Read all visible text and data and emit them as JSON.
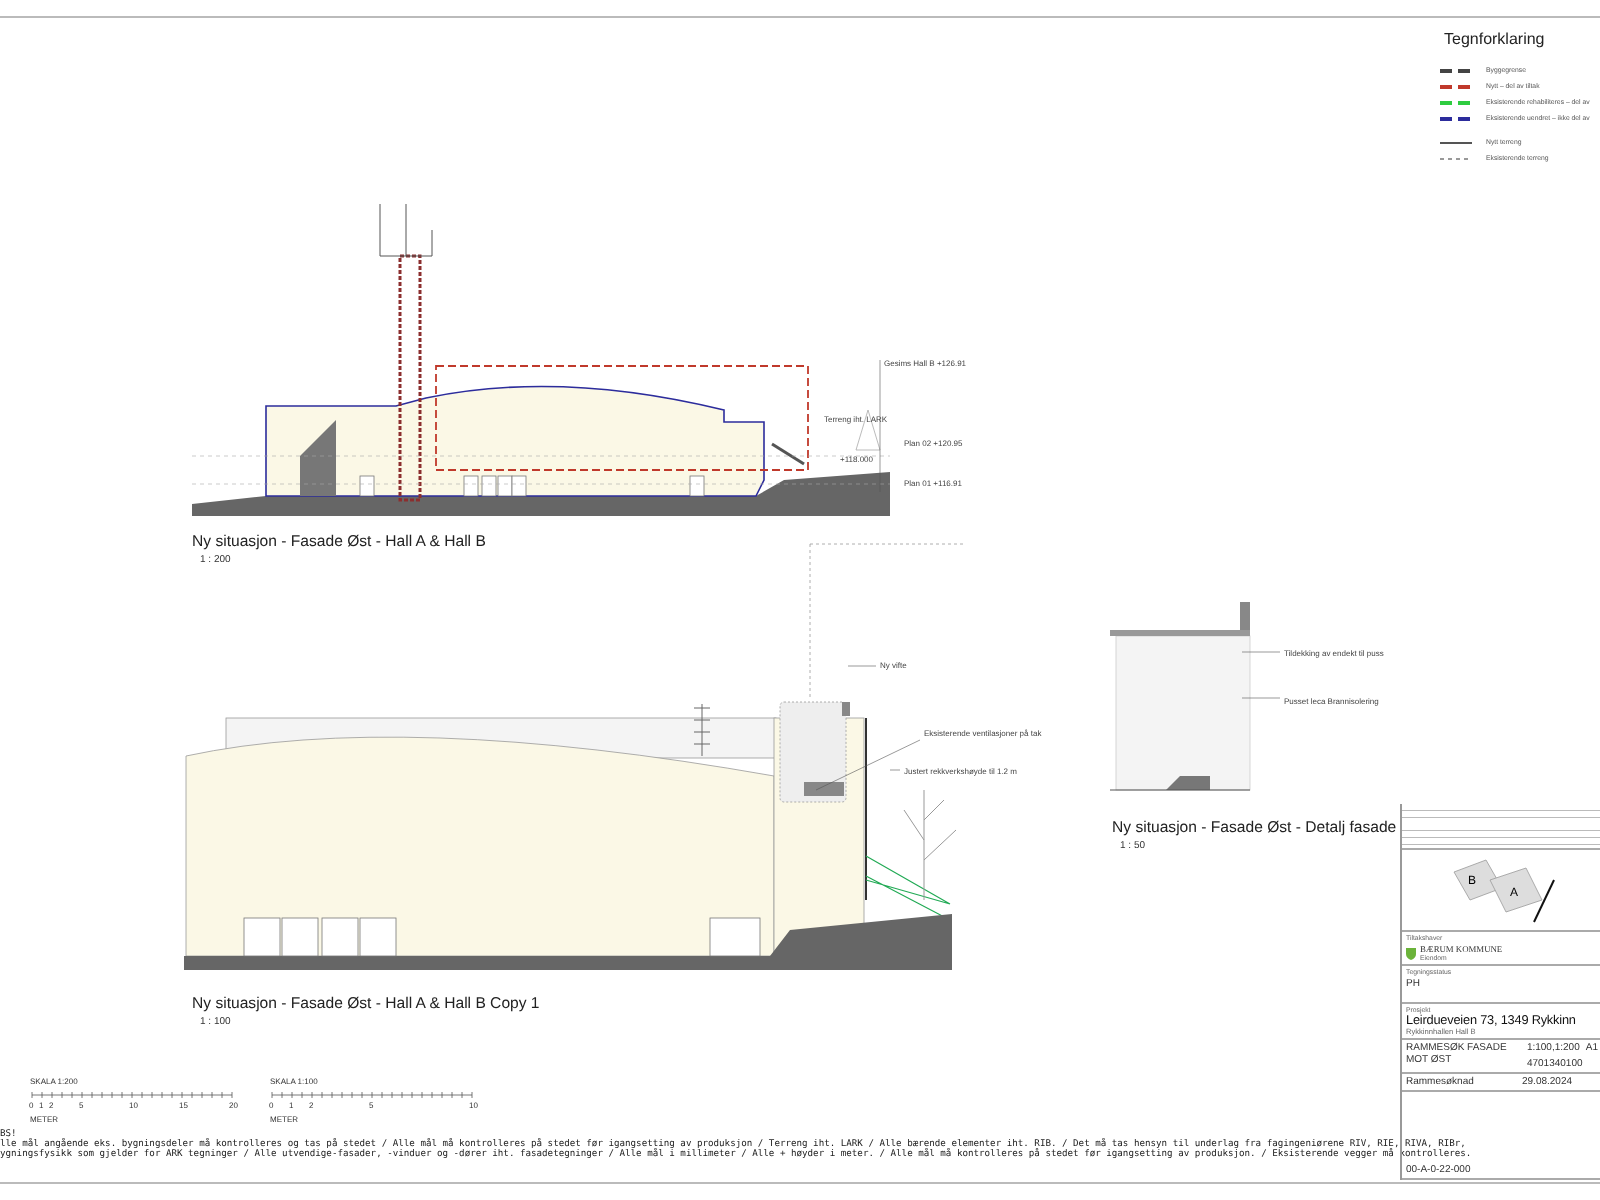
{
  "legend": {
    "title": "Tegnforklaring",
    "items": [
      {
        "label": "Byggegrense",
        "color": "#444444",
        "kind": "dashed"
      },
      {
        "label": "Nytt – del av tiltak",
        "color": "#c0392b",
        "kind": "dashed"
      },
      {
        "label": "Eksisterende rehabiliteres – del av",
        "color": "#2ecc40",
        "kind": "dashed"
      },
      {
        "label": "Eksisterende uendret – ikke del av",
        "color": "#2c2c9c",
        "kind": "dashed"
      },
      {
        "label": "Nytt terreng",
        "color": "#555555",
        "kind": "thin"
      },
      {
        "label": "Eksisterende terreng",
        "color": "#999999",
        "kind": "dotted"
      }
    ]
  },
  "views": [
    {
      "title": "Ny situasjon - Fasade Øst - Hall A & Hall B",
      "scale": "1 : 200",
      "annotations": [
        "Gesims Hall B +126.91",
        "Terreng iht. LARK",
        "Plan 02 +120.95",
        "+118.000",
        "Plan 01 +116.91"
      ]
    },
    {
      "title": "Ny situasjon - Fasade Øst - Hall A & Hall B Copy 1",
      "scale": "1 : 100",
      "annotations": [
        "Ny vifte",
        "Eksisterende ventilasjoner på tak",
        "Justert rekkverkshøyde til 1.2 m"
      ]
    },
    {
      "title": "Ny situasjon - Fasade Øst - Detalj fasade",
      "scale": "1 : 50",
      "annotations": [
        "Tildekking av endekt til puss",
        "Pusset leca Brannisolering"
      ]
    }
  ],
  "scale_bars": [
    {
      "title": "SKALA 1:200",
      "ticks": [
        "0",
        "1",
        "2",
        "5",
        "10",
        "15",
        "20"
      ],
      "unit": "METER"
    },
    {
      "title": "SKALA 1:100",
      "ticks": [
        "0",
        "1",
        "2",
        "5",
        "10"
      ],
      "unit": "METER"
    }
  ],
  "notes": {
    "title": "BS!",
    "lines": [
      "lle mål angående eks. bygningsdeler må kontrolleres og tas på stedet / Alle mål må kontrolleres på stedet før igangsetting av produksjon / Terreng iht. LARK / Alle bærende elementer iht. RIB. / Det må tas hensyn til underlag fra fagingeniørene RIV, RIE, RIVA, RIBr,",
      "ygningsfysikk som gjelder for ARK tegninger / Alle utvendige-fasader, -vinduer og -dører iht. fasadetegninger / Alle mål i millimeter / Alle + høyder i meter. / Alle mål må kontrolleres på stedet før igangsetting av produksjon. / Eksisterende vegger må kontrolleres."
    ]
  },
  "title_block": {
    "keymap_labels": [
      "B",
      "A"
    ],
    "client_label": "Tiltakshaver",
    "client": "BÆRUM KOMMUNE",
    "client_unit": "Eiendom",
    "designer_label": "Tegningsstatus",
    "designer": "PH",
    "project_label": "Prosjekt",
    "address": "Leirdueveien 73, 1349 Rykkinn",
    "project_name": "Rykkinnhallen Hall B",
    "drawing_title": "RAMMESØK FASADE MOT ØST",
    "scale": "1:100,1:200",
    "format": "A1",
    "project_no": "4701340100",
    "type": "Rammesøknad",
    "date": "29.08.2024",
    "drawing_no": "00-A-0-22-000"
  }
}
